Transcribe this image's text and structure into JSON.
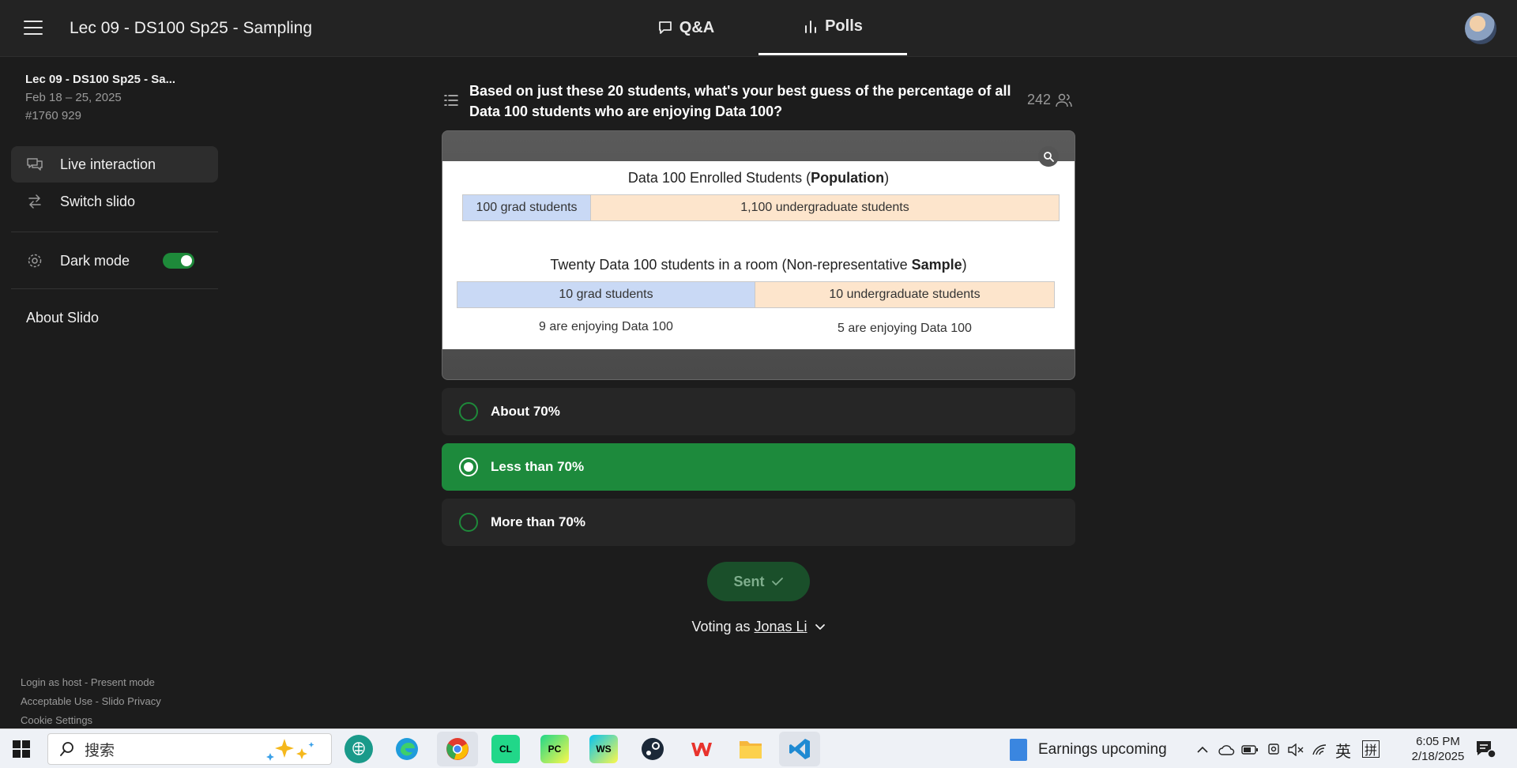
{
  "header": {
    "title": "Lec 09 - DS100 Sp25 - Sampling",
    "tabs": [
      {
        "label": "Q&A",
        "icon": "chat-bubble-icon"
      },
      {
        "label": "Polls",
        "icon": "bar-chart-icon"
      }
    ]
  },
  "sidebar": {
    "event_name": "Lec 09 - DS100 Sp25 - Sa...",
    "event_dates": "Feb 18 – 25, 2025",
    "event_code": "#1760 929",
    "items": [
      {
        "label": "Live interaction",
        "icon": "chat-icon"
      },
      {
        "label": "Switch slido",
        "icon": "swap-arrows-icon"
      },
      {
        "label": "Dark mode",
        "icon": "gear-icon"
      }
    ],
    "dark_mode_on": true,
    "about": "About Slido",
    "footer": {
      "line1a": "Login as host",
      "line1sep": " - ",
      "line1b": "Present mode",
      "line2a": "Acceptable Use",
      "line2sep": " - ",
      "line2b": "Slido Privacy",
      "line3": "Cookie Settings"
    }
  },
  "poll": {
    "question": "Based on just these 20 students, what's your best guess of the percentage of all Data 100 students who are enjoying Data 100?",
    "voter_count": "242",
    "slide": {
      "population_title_prefix": "Data 100 Enrolled Students (",
      "population_title_bold": "Population",
      "population_title_suffix": ")",
      "population_grad": "100 grad students",
      "population_undergrad": "1,100 undergraduate students",
      "sample_title_prefix": "Twenty Data 100 students in a room (Non-representative ",
      "sample_title_bold": "Sample",
      "sample_title_suffix": ")",
      "sample_grad": "10 grad students",
      "sample_undergrad": "10 undergraduate students",
      "grad_enjoying": "9 are enjoying Data 100",
      "undergrad_enjoying": "5 are enjoying Data 100"
    },
    "options": [
      {
        "label": "About 70%",
        "selected": false
      },
      {
        "label": "Less than 70%",
        "selected": true
      },
      {
        "label": "More than 70%",
        "selected": false
      }
    ],
    "sent_label": "Sent",
    "voting_as_prefix": "Voting as ",
    "voter_name": "Jonas Li"
  },
  "taskbar": {
    "search_placeholder": "搜索",
    "apps": [
      "brain-app-icon",
      "edge-icon",
      "chrome-icon",
      "clion-icon",
      "pycharm-icon",
      "webstorm-icon",
      "steam-icon",
      "wps-icon",
      "file-explorer-icon",
      "vscode-icon"
    ],
    "app_labels": {
      "clion": "CL",
      "pycharm": "PC",
      "webstorm": "WS"
    },
    "news": "Earnings upcoming",
    "ime_lang": "英",
    "ime_mode": "拼",
    "time": "6:05 PM",
    "date": "2/18/2025"
  },
  "colors": {
    "accent_green": "#1d8a3c",
    "background": "#1c1c1c",
    "grad_blue": "#c9d9f5",
    "undergrad_peach": "#fde5cc"
  }
}
